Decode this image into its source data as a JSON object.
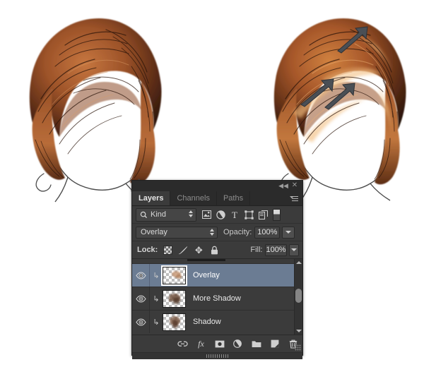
{
  "document": {
    "title": "Photoshop layers panel over hair illustration tutorial"
  },
  "illustrations": [
    {
      "name": "hair-before",
      "description": "Auburn hair illustration without added highlights"
    },
    {
      "name": "hair-after",
      "description": "Auburn hair illustration with overlay highlights and three annotation arrows"
    }
  ],
  "annotations": {
    "arrow_count": 3,
    "arrow_color": "#4a4f55"
  },
  "panel": {
    "titlebar": {
      "collapse_icon": "collapse-double-arrow-icon",
      "collapse_glyph": "◀◀",
      "close_icon": "close-icon",
      "close_glyph": "✕"
    },
    "tabs": [
      {
        "label": "Layers",
        "active": true
      },
      {
        "label": "Channels",
        "active": false
      },
      {
        "label": "Paths",
        "active": false
      }
    ],
    "menu_icon": "panel-menu-icon",
    "filter": {
      "search_icon": "search-icon",
      "kind_label": "Kind",
      "stepper_icon": "stepper-updown-icon",
      "icons": [
        {
          "name": "filter-pixel-layers-icon",
          "glyph": "▣"
        },
        {
          "name": "filter-adjustment-layers-icon",
          "glyph": "◐"
        },
        {
          "name": "filter-type-layers-icon",
          "glyph": "T"
        },
        {
          "name": "filter-shape-layers-icon",
          "glyph": "⬚"
        },
        {
          "name": "filter-smart-objects-icon",
          "glyph": "❐"
        }
      ],
      "toggle_icon": "filter-enable-toggle-icon"
    },
    "blend": {
      "mode": "Overlay",
      "opacity_label": "Opacity:",
      "opacity_value": "100%"
    },
    "lock": {
      "label": "Lock:",
      "icons": [
        {
          "name": "lock-transparent-pixels-icon"
        },
        {
          "name": "lock-image-pixels-icon",
          "glyph": "🖌"
        },
        {
          "name": "lock-position-icon",
          "glyph": "✥"
        },
        {
          "name": "lock-all-icon",
          "glyph": "🔒"
        }
      ],
      "fill_label": "Fill:",
      "fill_value": "100%"
    },
    "layers": [
      {
        "name": "Overlay",
        "visible": true,
        "selected": true,
        "clipped": true,
        "visibility_icon": "eye-icon",
        "clipping_icon": "clipping-mask-arrow-icon",
        "thumbnail": "layer-thumbnail"
      },
      {
        "name": "More Shadow",
        "visible": true,
        "selected": false,
        "clipped": true,
        "visibility_icon": "eye-icon",
        "clipping_icon": "clipping-mask-arrow-icon",
        "thumbnail": "layer-thumbnail"
      },
      {
        "name": "Shadow",
        "visible": true,
        "selected": false,
        "clipped": true,
        "visibility_icon": "eye-icon",
        "clipping_icon": "clipping-mask-arrow-icon",
        "thumbnail": "layer-thumbnail"
      }
    ],
    "scrollbar": {
      "up_icon": "scroll-up-arrow-icon",
      "down_icon": "scroll-down-arrow-icon",
      "thumb": "scrollbar-thumb"
    },
    "footer_buttons": [
      {
        "name": "link-layers-button",
        "glyph": "⛓"
      },
      {
        "name": "layer-style-fx-button",
        "glyph": "fx"
      },
      {
        "name": "add-layer-mask-button",
        "glyph": "▣"
      },
      {
        "name": "new-adjustment-layer-button",
        "glyph": "◐"
      },
      {
        "name": "new-group-button",
        "glyph": "▰"
      },
      {
        "name": "new-layer-button",
        "glyph": "❐"
      },
      {
        "name": "delete-layer-button",
        "glyph": "🗑"
      }
    ],
    "resize_grip": "resize-grip-icon"
  },
  "colors": {
    "panel_bg": "#3b3b3b",
    "panel_dark": "#2b2b2b",
    "selected_row": "#6b7c93",
    "text": "#d2d2d2",
    "hair_dark": "#3a1d10",
    "hair_mid": "#8b4a26",
    "hair_light": "#c87a44"
  }
}
